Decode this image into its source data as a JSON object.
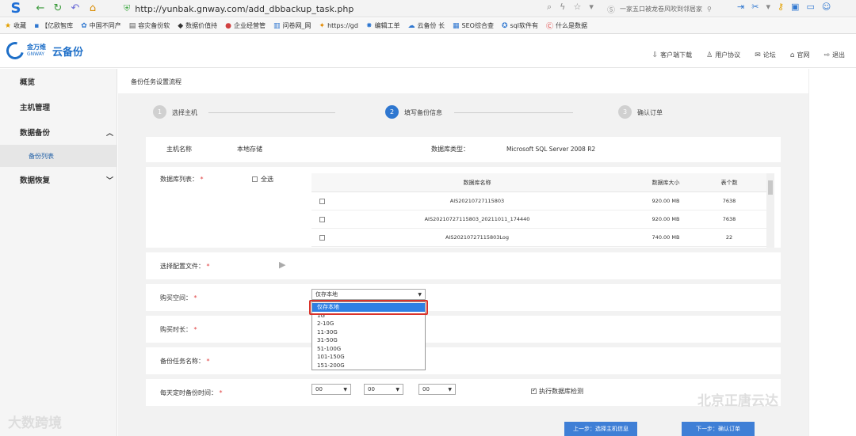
{
  "browser": {
    "url": "http://yunbak.gnway.com/add_dbbackup_task.php",
    "search_placeholder": "一家五口被龙卷风吹到邻居家",
    "bookmarks": [
      "收藏",
      "【亿欧智库",
      "中国不同产",
      "容灾备份软",
      "数据价值持",
      "企业经营管",
      "问卷网_网",
      "https://gd",
      "编辑工单",
      "云备份 长",
      "SEO综合查",
      "sql软件有",
      "什么是数据"
    ]
  },
  "header": {
    "logo_cn": "金万维",
    "logo_en": "GNWAY",
    "product": "云备份",
    "links": [
      "客户端下载",
      "用户协议",
      "论坛",
      "官网",
      "退出"
    ]
  },
  "sidebar": {
    "items": [
      {
        "label": "概览"
      },
      {
        "label": "主机管理"
      },
      {
        "label": "数据备份"
      },
      {
        "label": "备份列表"
      },
      {
        "label": "数据恢复"
      }
    ]
  },
  "main": {
    "title": "备份任务设置流程",
    "steps": [
      {
        "num": "1",
        "label": "选择主机"
      },
      {
        "num": "2",
        "label": "填写备份信息"
      },
      {
        "num": "3",
        "label": "确认订单"
      }
    ],
    "host_label": "主机名称",
    "host_value": "本地存储",
    "dbtype_label": "数据库类型：",
    "dbtype_value": "Microsoft SQL Server 2008 R2",
    "dblist_label": "数据库列表：",
    "select_all": "全选",
    "table": {
      "headers": [
        "数据库名称",
        "数据库大小",
        "表个数"
      ],
      "rows": [
        {
          "name": "AIS20210727115803",
          "size": "920.00 MB",
          "count": "7638"
        },
        {
          "name": "AIS20210727115803_20211011_174440",
          "size": "920.00 MB",
          "count": "7638"
        },
        {
          "name": "AIS20210727115803Log",
          "size": "740.00 MB",
          "count": "22"
        }
      ]
    },
    "config_label": "选择配置文件：",
    "space_label": "购买空间：",
    "space_value": "仅存本地",
    "space_options": [
      "仅存本地",
      "1G",
      "2-10G",
      "11-30G",
      "31-50G",
      "51-100G",
      "101-150G",
      "151-200G"
    ],
    "duration_label": "购买时长：",
    "taskname_label": "备份任务名称：",
    "time_label": "每天定时备份时间：",
    "time_values": [
      "00",
      "00",
      "00"
    ],
    "check_label": "执行数据库检测",
    "btn_prev": "上一步：选择主机信息",
    "btn_next": "下一步：确认订单"
  },
  "watermark": {
    "left": "大数跨境",
    "right": "北京正唐云达"
  }
}
